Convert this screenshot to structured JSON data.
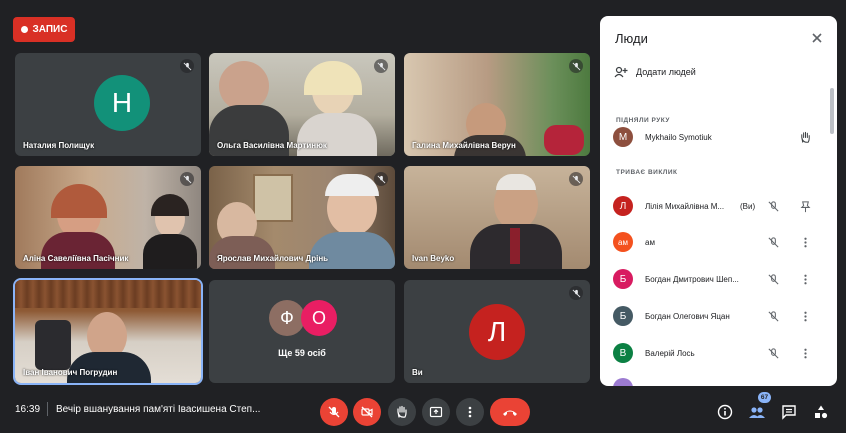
{
  "recording": {
    "label": "ЗАПИС"
  },
  "tiles": [
    {
      "name": "Наталия Полищук",
      "avatar_letter": "Н",
      "avatar_color": "#129179"
    },
    {
      "name": "Ольга Василівна Мартинюк"
    },
    {
      "name": "Галина Михайлівна Верун"
    },
    {
      "name": "Аліна Савеліївна Пасічник"
    },
    {
      "name": "Ярослав Михайлович Дрінь"
    },
    {
      "name": "Ivan Beyko"
    },
    {
      "name": "Іван Іванович Погрудин"
    },
    {
      "more_label": "Ще 59 осіб",
      "letters": [
        "Ф",
        "О"
      ],
      "colors": [
        "#8d6e63",
        "#e91e63"
      ]
    },
    {
      "name": "Ви",
      "avatar_letter": "Л",
      "avatar_color": "#c5221f"
    }
  ],
  "panel": {
    "title": "Люди",
    "add_people": "Додати людей",
    "raised_hands_label": "ПІДНЯЛИ РУКУ",
    "raised": {
      "letter": "M",
      "name": "Mykhailo Symotiuk",
      "color": "#8d4f3e"
    },
    "in_call_label": "ТРИВАЄ ВИКЛИК",
    "participants": [
      {
        "letter": "Л",
        "name": "Лілія Михайлівна М...",
        "suffix": "(Ви)",
        "color": "#c5221f"
      },
      {
        "letter": "ам",
        "name": "ам",
        "suffix": "",
        "color": "#f4511e"
      },
      {
        "letter": "Б",
        "name": "Богдан Дмитрович Шеп...",
        "suffix": "",
        "color": "#d81b60"
      },
      {
        "letter": "Б",
        "name": "Богдан Олегович Яцан",
        "suffix": "",
        "color": "#455a64"
      },
      {
        "letter": "В",
        "name": "Валерій Лось",
        "suffix": "",
        "color": "#0b8043"
      }
    ]
  },
  "bottom": {
    "time": "16:39",
    "meeting_title": "Вечір вшанування пам'яті Івасишена Степ...",
    "participant_count": "67"
  }
}
